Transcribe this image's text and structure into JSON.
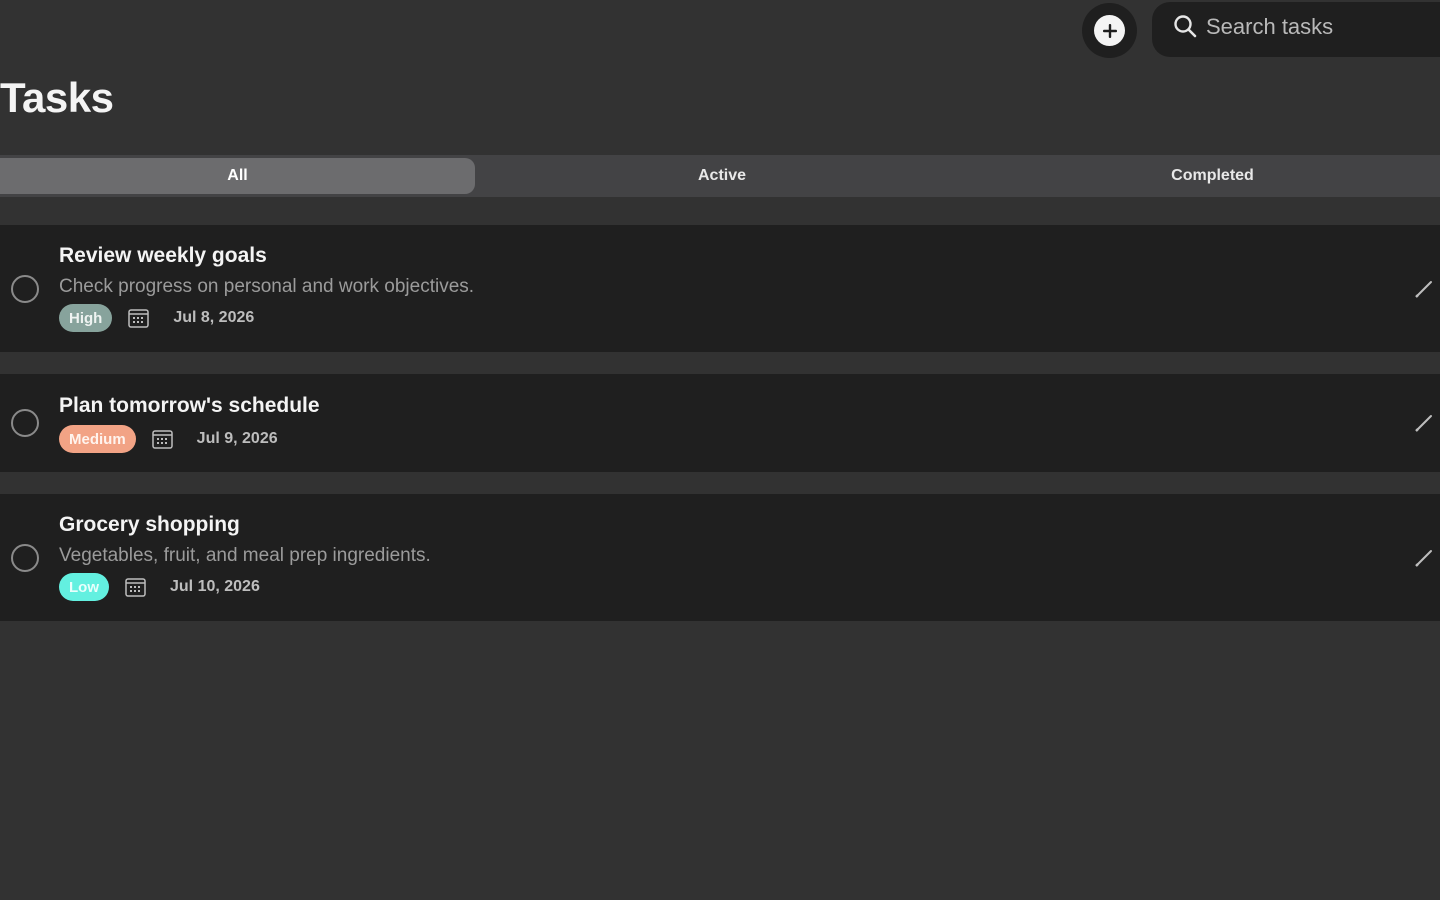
{
  "header": {
    "title": "Tasks",
    "add_icon": "plus-circle-icon",
    "search": {
      "placeholder": "Search tasks",
      "value": "",
      "icon": "search-icon"
    }
  },
  "filters": {
    "selected": "All",
    "tabs": [
      {
        "label": "All"
      },
      {
        "label": "Active"
      },
      {
        "label": "Completed"
      }
    ]
  },
  "tasks": [
    {
      "title": "Review weekly goals",
      "description": "Check progress on personal and work objectives.",
      "priority": "High",
      "date": "Jul 8, 2026",
      "completed": false
    },
    {
      "title": "Plan tomorrow's schedule",
      "description": "",
      "priority": "Medium",
      "date": "Jul 9, 2026",
      "completed": false
    },
    {
      "title": "Grocery shopping",
      "description": "Vegetables, fruit, and meal prep ingredients.",
      "priority": "Low",
      "date": "Jul 10, 2026",
      "completed": false
    }
  ],
  "colors": {
    "background": "#323232",
    "card": "#1f1f1f",
    "high": "#87a39c",
    "medium": "#f2a385",
    "low": "#63f0e0"
  }
}
